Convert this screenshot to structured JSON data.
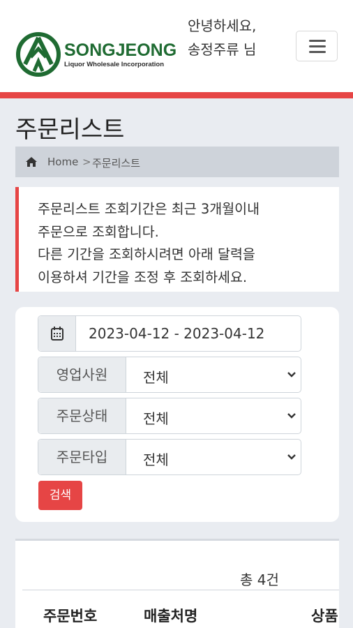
{
  "header": {
    "logo": {
      "name": "SONGJEONG",
      "subtitle": "Liquor Wholesale Incorporation"
    },
    "greeting_line1": "안녕하세요,",
    "greeting_line2": "송정주류 님",
    "menu_icon": "hamburger-icon"
  },
  "colors": {
    "accent": "#e64545",
    "brand_green": "#1f6b32"
  },
  "page": {
    "title": "주문리스트",
    "breadcrumb": {
      "home": "Home",
      "separator": ">",
      "current": "주문리스트"
    }
  },
  "notice": {
    "line1": "주문리스트 조회기간은 최근 3개월이내",
    "line2": "주문으로 조회합니다.",
    "line3": "다른 기간을 조회하시려면 아래 달력을",
    "line4": "이용하셔 기간을 조정 후 조회하세요."
  },
  "filters": {
    "date_range": "2023-04-12 - 2023-04-12",
    "sales_rep": {
      "label": "영업사원",
      "value": "전체"
    },
    "order_status": {
      "label": "주문상태",
      "value": "전체"
    },
    "order_type": {
      "label": "주문타입",
      "value": "전체"
    },
    "search_label": "검색"
  },
  "results": {
    "total": "총 4건",
    "columns": [
      "주문번호",
      "매출처명",
      "상품"
    ]
  }
}
